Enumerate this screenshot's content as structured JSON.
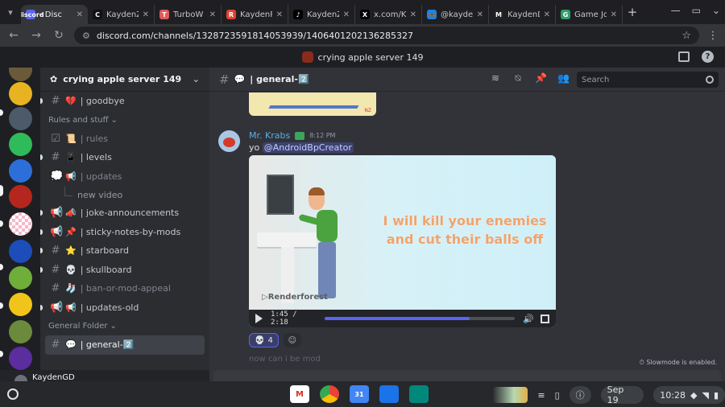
{
  "browser": {
    "tabs": [
      {
        "title": "- Disc",
        "fav": "discord",
        "fav_color": "#5865f2",
        "active": true
      },
      {
        "title": "KaydenZ",
        "fav": "C",
        "fav_color": "#111111"
      },
      {
        "title": "TurboW",
        "fav": "T",
        "fav_color": "#e25a5a"
      },
      {
        "title": "KaydenR",
        "fav": "R",
        "fav_color": "#e34234"
      },
      {
        "title": "KaydenZ",
        "fav": "♪",
        "fav_color": "#000000"
      },
      {
        "title": "x.com/K",
        "fav": "X",
        "fav_color": "#000000"
      },
      {
        "title": "@kayden",
        "fav": "🦋",
        "fav_color": "#1185fe"
      },
      {
        "title": "KaydenD",
        "fav": "M",
        "fav_color": "#222222"
      },
      {
        "title": "Game Jo",
        "fav": "G",
        "fav_color": "#2e9e6b"
      }
    ],
    "url": "discord.com/channels/1328723591814053939/1406401202136285327"
  },
  "window_title": "crying apple server 149",
  "server": {
    "name": "crying apple server 149",
    "channels": [
      {
        "type": "channel",
        "emoji": "💔",
        "name": "| goodbye",
        "icon": "hash",
        "unread": true
      },
      {
        "type": "category",
        "name": "Rules and stuff"
      },
      {
        "type": "channel",
        "emoji": "📜",
        "name": "| rules",
        "icon": "rules-check",
        "muted": true
      },
      {
        "type": "channel",
        "emoji": "📱",
        "name": "| levels",
        "icon": "hash",
        "unread": true
      },
      {
        "type": "channel",
        "emoji": "📢",
        "name": "| updates",
        "icon": "forum",
        "muted": true
      },
      {
        "type": "thread",
        "name": "new video"
      },
      {
        "type": "channel",
        "emoji": "📣",
        "name": "| joke-announcements",
        "icon": "megaphone",
        "unread": true
      },
      {
        "type": "channel",
        "emoji": "📌",
        "name": "| sticky-notes-by-mods",
        "icon": "megaphone",
        "unread": true
      },
      {
        "type": "channel",
        "emoji": "⭐",
        "name": "| starboard",
        "icon": "hash",
        "unread": true
      },
      {
        "type": "channel",
        "emoji": "💀",
        "name": "| skullboard",
        "icon": "hash",
        "unread": true
      },
      {
        "type": "channel",
        "emoji": "🧦",
        "name": "| ban-or-mod-appeal",
        "icon": "hash",
        "muted": true
      },
      {
        "type": "channel",
        "emoji": "📢",
        "name": "| updates-old",
        "icon": "megaphone",
        "unread": true
      },
      {
        "type": "category",
        "name": "General Folder"
      },
      {
        "type": "channel",
        "emoji": "💬",
        "name": "| general-2️⃣",
        "icon": "hash",
        "selected": true
      }
    ]
  },
  "user": {
    "name": "KaydenGD"
  },
  "channel_header": {
    "emoji": "💬",
    "name": "| general-2️⃣",
    "search_placeholder": "Search"
  },
  "message": {
    "author": "Mr. Krabs",
    "time": "8:12 PM",
    "text": "yo",
    "mention": "@AndroidBpCreator",
    "video": {
      "caption": "I will kill your enemies and cut their balls off",
      "watermark": "▷Renderforest",
      "time": "1:45 / 2:18",
      "progress": 0.76
    },
    "reactions": [
      {
        "emoji": "💀",
        "count": "4"
      }
    ]
  },
  "next_message_ghost": "now can i be mod",
  "slowmode": "Slowmode is enabled.",
  "shelf": {
    "date": "Sep 19",
    "time": "10:28"
  },
  "colors": {
    "accent": "#5865f2",
    "author": "#5dade2",
    "selected_channel": "#404249"
  }
}
